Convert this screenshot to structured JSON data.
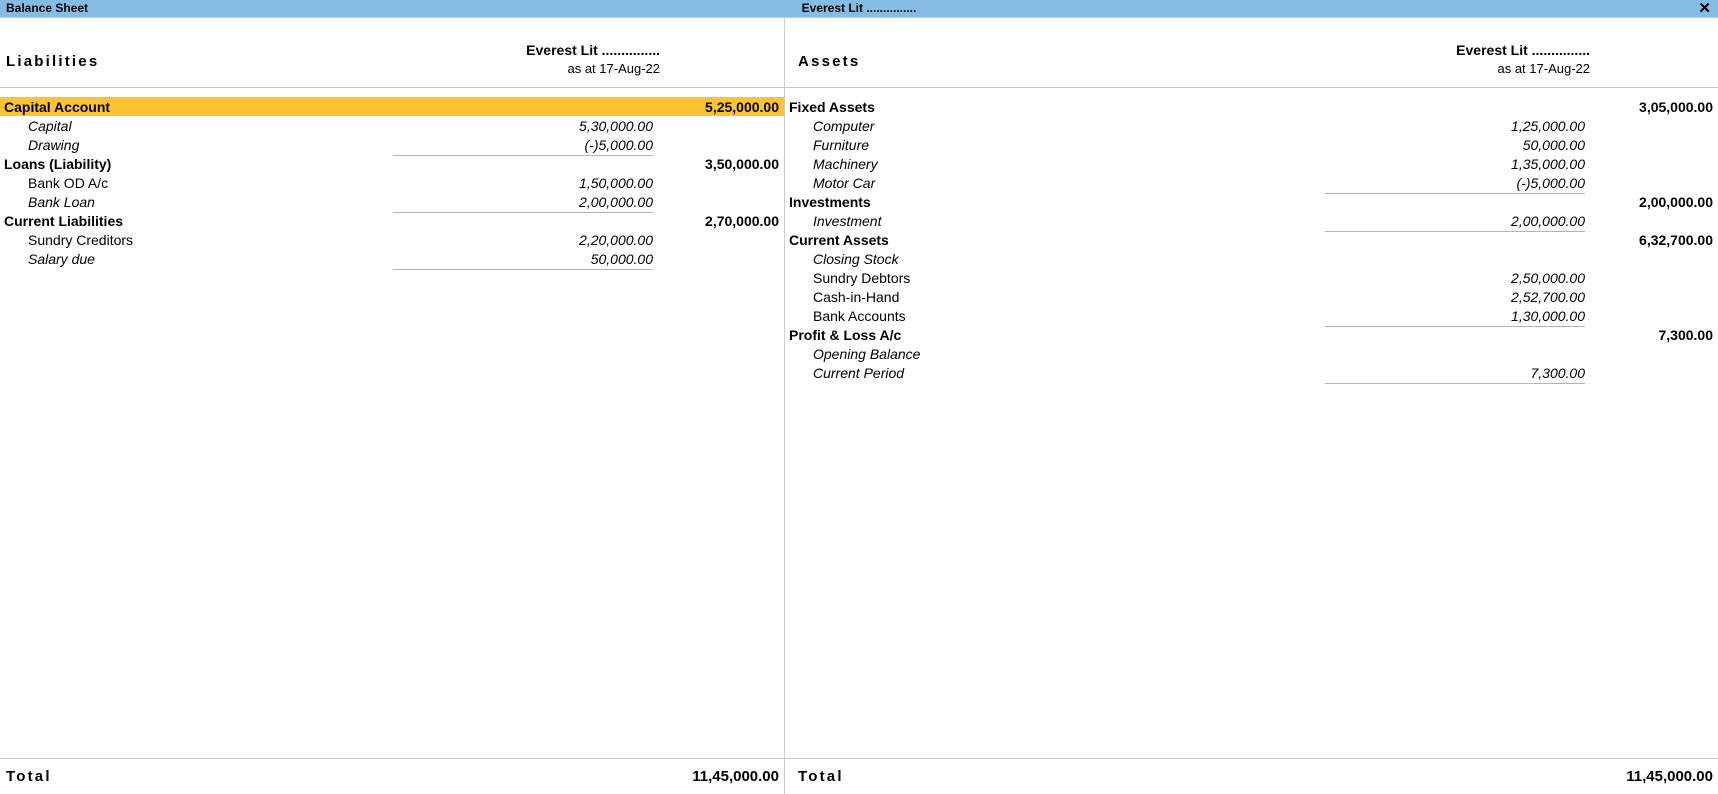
{
  "titlebar": {
    "left_label": "Balance Sheet",
    "center_label": "Everest Lit ...............",
    "close_label": "✕"
  },
  "liabilities": {
    "side_title": "Liabilities",
    "company": "Everest Lit ...............",
    "as_at": "as at 17-Aug-22",
    "groups": [
      {
        "name": "Capital Account",
        "amount": "5,25,000.00",
        "highlight": true,
        "items": [
          {
            "label": "Capital",
            "amount": "5,30,000.00",
            "italic": true
          },
          {
            "label": "Drawing",
            "amount": "(-)5,000.00",
            "italic": true,
            "ruled": true
          }
        ]
      },
      {
        "name": "Loans (Liability)",
        "amount": "3,50,000.00",
        "highlight": false,
        "items": [
          {
            "label": "Bank OD A/c",
            "amount": "1,50,000.00",
            "italic": false
          },
          {
            "label": "Bank Loan",
            "amount": "2,00,000.00",
            "italic": true,
            "ruled": true
          }
        ]
      },
      {
        "name": "Current Liabilities",
        "amount": "2,70,000.00",
        "highlight": false,
        "items": [
          {
            "label": "Sundry Creditors",
            "amount": "2,20,000.00",
            "italic": false
          },
          {
            "label": "Salary due",
            "amount": "50,000.00",
            "italic": true,
            "ruled": true
          }
        ]
      }
    ],
    "total_label": "Total",
    "total_amount": "11,45,000.00"
  },
  "assets": {
    "side_title": "Assets",
    "company": "Everest Lit ...............",
    "as_at": "as at 17-Aug-22",
    "groups": [
      {
        "name": "Fixed Assets",
        "amount": "3,05,000.00",
        "highlight": false,
        "items": [
          {
            "label": "Computer",
            "amount": "1,25,000.00",
            "italic": true
          },
          {
            "label": "Furniture",
            "amount": "50,000.00",
            "italic": true
          },
          {
            "label": "Machinery",
            "amount": "1,35,000.00",
            "italic": true
          },
          {
            "label": "Motor Car",
            "amount": "(-)5,000.00",
            "italic": true,
            "ruled": true
          }
        ]
      },
      {
        "name": "Investments",
        "amount": "2,00,000.00",
        "highlight": false,
        "items": [
          {
            "label": "Investment",
            "amount": "2,00,000.00",
            "italic": true,
            "ruled": true
          }
        ]
      },
      {
        "name": "Current Assets",
        "amount": "6,32,700.00",
        "highlight": false,
        "items": [
          {
            "label": "Closing Stock",
            "amount": "",
            "italic": true
          },
          {
            "label": "Sundry Debtors",
            "amount": "2,50,000.00",
            "italic": false
          },
          {
            "label": "Cash-in-Hand",
            "amount": "2,52,700.00",
            "italic": false
          },
          {
            "label": "Bank Accounts",
            "amount": "1,30,000.00",
            "italic": false,
            "ruled": true
          }
        ]
      },
      {
        "name": "Profit & Loss A/c",
        "amount": "7,300.00",
        "highlight": false,
        "items": [
          {
            "label": "Opening Balance",
            "amount": "",
            "italic": true
          },
          {
            "label": "Current Period",
            "amount": "7,300.00",
            "italic": true,
            "ruled": true
          }
        ]
      }
    ],
    "total_label": "Total",
    "total_amount": "11,45,000.00"
  },
  "colors": {
    "titlebar": "#85bce4",
    "highlight": "#fcc331",
    "rule": "#b4b4b4"
  }
}
